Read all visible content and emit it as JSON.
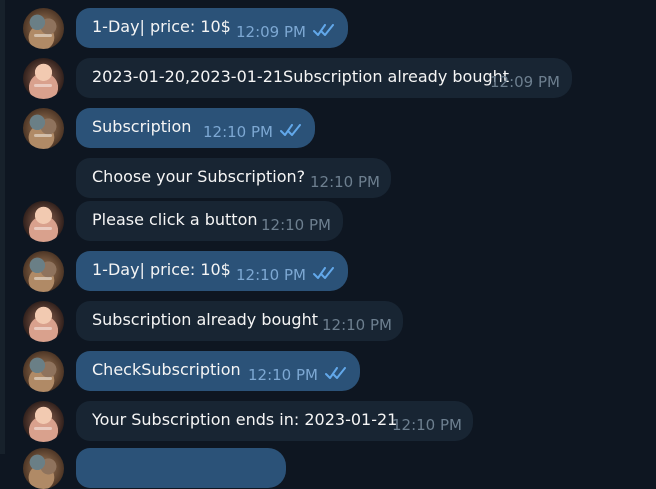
{
  "messages": [
    {
      "sender": "user",
      "text": "1-Day| price: 10$",
      "time": "12:09 PM",
      "read": true
    },
    {
      "sender": "bot",
      "text": "2023-01-20,2023-01-21Subscription already bought",
      "time": "12:09 PM"
    },
    {
      "sender": "user",
      "text": "Subscription",
      "time": "12:10 PM",
      "read": true
    },
    {
      "sender": "bot",
      "text": "Choose your Subscription?",
      "time": "12:10 PM"
    },
    {
      "sender": "bot",
      "text": "Please click a button",
      "time": "12:10 PM"
    },
    {
      "sender": "user",
      "text": "1-Day| price: 10$",
      "time": "12:10 PM",
      "read": true
    },
    {
      "sender": "bot",
      "text": "Subscription already bought",
      "time": "12:10 PM"
    },
    {
      "sender": "user",
      "text": "CheckSubscription",
      "time": "12:10 PM",
      "read": true
    },
    {
      "sender": "bot",
      "text": "Your Subscription ends in: 2023-01-21",
      "time": "12:10 PM"
    }
  ],
  "colors": {
    "background": "#0e1621",
    "outgoing": "#2b5278",
    "incoming": "#182533",
    "read_check": "#62a8ea"
  },
  "icons": {
    "read_receipt": "double-check-icon",
    "user_avatar": "user-avatar",
    "bot_avatar": "bot-avatar"
  }
}
